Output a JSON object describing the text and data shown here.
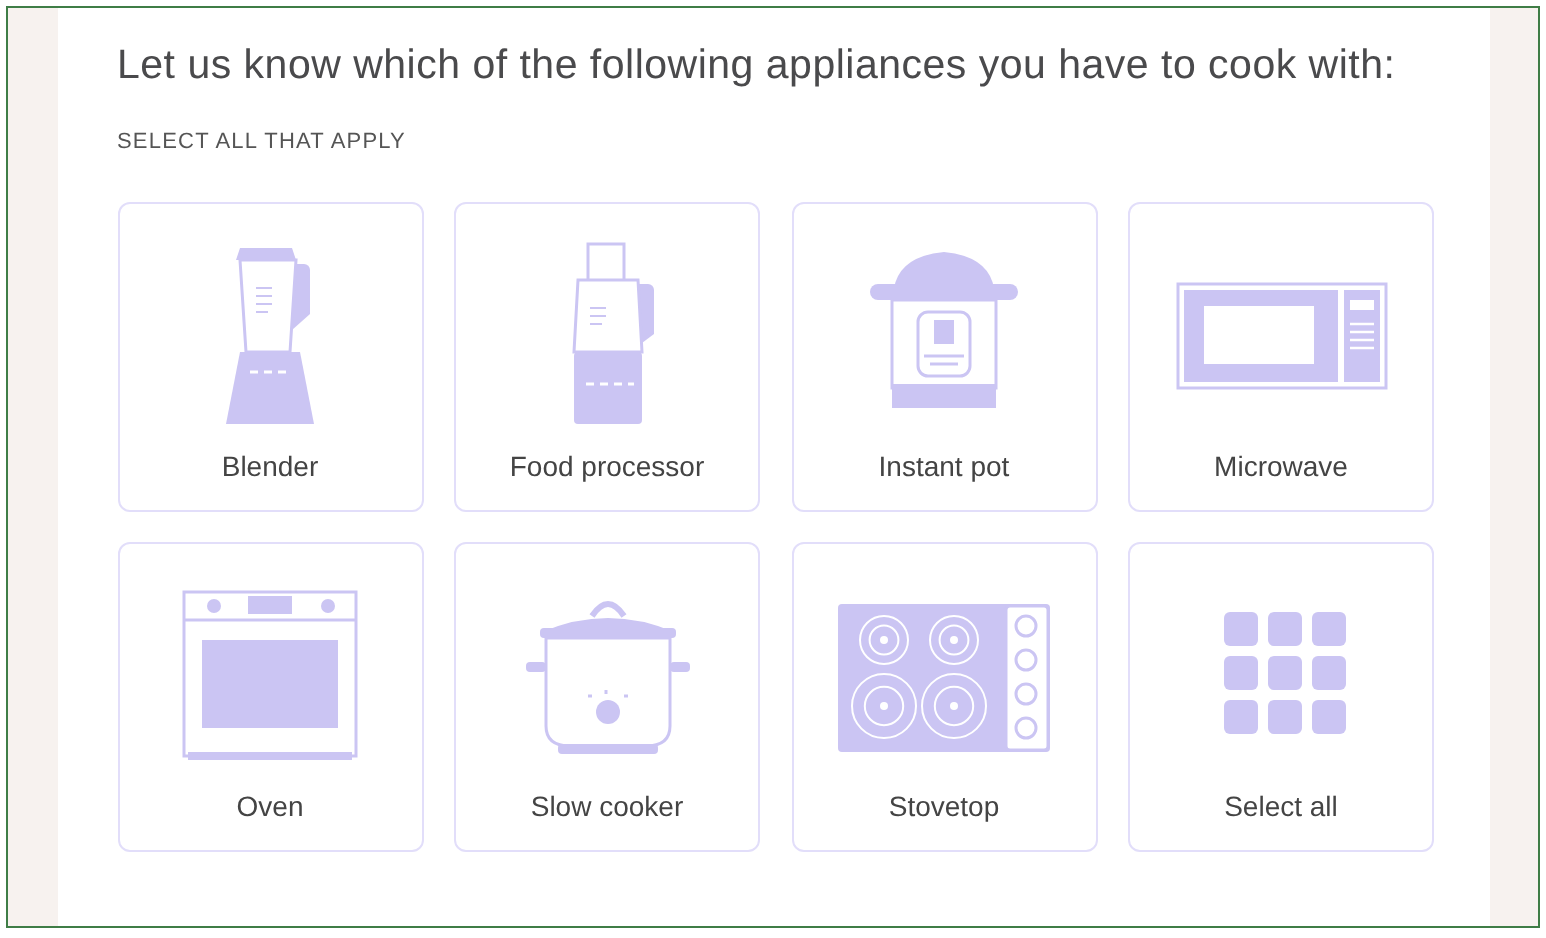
{
  "question": "Let us know which of the following appliances you have to cook with:",
  "instruction": "SELECT ALL THAT APPLY",
  "options": [
    {
      "kind": "blender",
      "label": "Blender",
      "selected": false
    },
    {
      "kind": "food_processor",
      "label": "Food processor",
      "selected": false
    },
    {
      "kind": "instant_pot",
      "label": "Instant pot",
      "selected": false
    },
    {
      "kind": "microwave",
      "label": "Microwave",
      "selected": false
    },
    {
      "kind": "oven",
      "label": "Oven",
      "selected": false
    },
    {
      "kind": "slow_cooker",
      "label": "Slow cooker",
      "selected": false
    },
    {
      "kind": "stovetop",
      "label": "Stovetop",
      "selected": false
    },
    {
      "kind": "select_all",
      "label": "Select all",
      "selected": false
    }
  ]
}
